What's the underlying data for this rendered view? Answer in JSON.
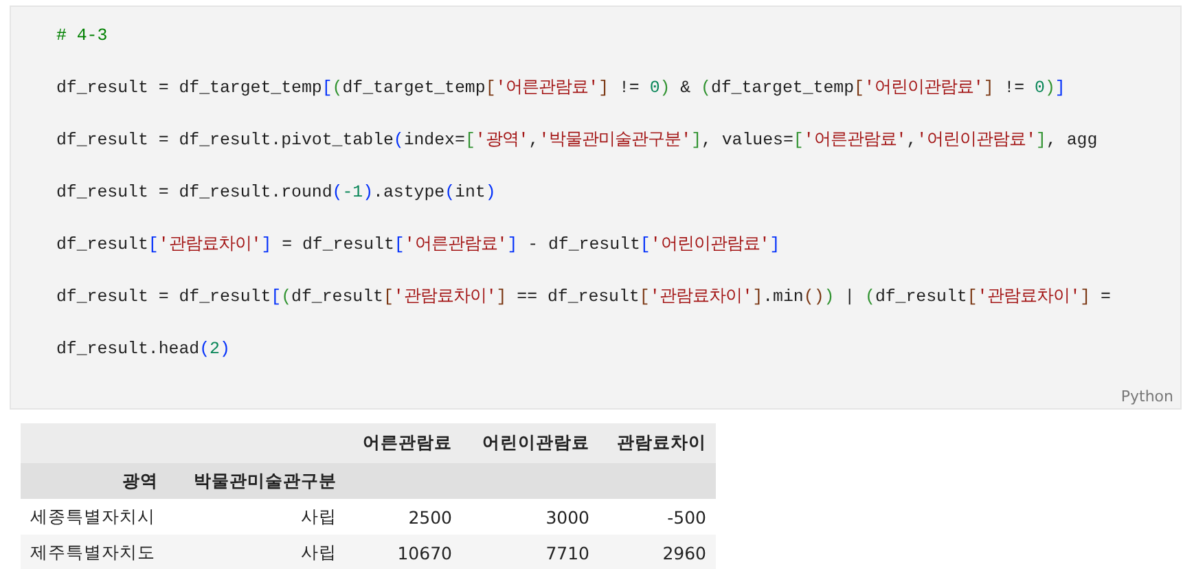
{
  "code_cell": {
    "language": "Python",
    "lines": [
      [
        {
          "text": "# 4-3",
          "kind": "c"
        }
      ],
      [
        {
          "text": "df_result = df_target_temp",
          "kind": "p"
        },
        {
          "text": "[",
          "kind": "b1"
        },
        {
          "text": "(",
          "kind": "b2"
        },
        {
          "text": "df_target_temp",
          "kind": "p"
        },
        {
          "text": "[",
          "kind": "b3"
        },
        {
          "text": "'어른관람료'",
          "kind": "s"
        },
        {
          "text": "]",
          "kind": "b3"
        },
        {
          "text": " != ",
          "kind": "p"
        },
        {
          "text": "0",
          "kind": "n"
        },
        {
          "text": ")",
          "kind": "b2"
        },
        {
          "text": " & ",
          "kind": "p"
        },
        {
          "text": "(",
          "kind": "b2"
        },
        {
          "text": "df_target_temp",
          "kind": "p"
        },
        {
          "text": "[",
          "kind": "b3"
        },
        {
          "text": "'어린이관람료'",
          "kind": "s"
        },
        {
          "text": "]",
          "kind": "b3"
        },
        {
          "text": " != ",
          "kind": "p"
        },
        {
          "text": "0",
          "kind": "n"
        },
        {
          "text": ")",
          "kind": "b2"
        },
        {
          "text": "]",
          "kind": "b1"
        }
      ],
      [
        {
          "text": "df_result = df_result.pivot_table",
          "kind": "p"
        },
        {
          "text": "(",
          "kind": "b1"
        },
        {
          "text": "index=",
          "kind": "p"
        },
        {
          "text": "[",
          "kind": "b2"
        },
        {
          "text": "'광역'",
          "kind": "s"
        },
        {
          "text": ",",
          "kind": "p"
        },
        {
          "text": "'박물관미술관구분'",
          "kind": "s"
        },
        {
          "text": "]",
          "kind": "b2"
        },
        {
          "text": ", values=",
          "kind": "p"
        },
        {
          "text": "[",
          "kind": "b2"
        },
        {
          "text": "'어른관람료'",
          "kind": "s"
        },
        {
          "text": ",",
          "kind": "p"
        },
        {
          "text": "'어린이관람료'",
          "kind": "s"
        },
        {
          "text": "]",
          "kind": "b2"
        },
        {
          "text": ", agg",
          "kind": "p"
        }
      ],
      [
        {
          "text": "df_result = df_result.round",
          "kind": "p"
        },
        {
          "text": "(",
          "kind": "b1"
        },
        {
          "text": "-1",
          "kind": "n"
        },
        {
          "text": ")",
          "kind": "b1"
        },
        {
          "text": ".astype",
          "kind": "p"
        },
        {
          "text": "(",
          "kind": "b1"
        },
        {
          "text": "int",
          "kind": "p"
        },
        {
          "text": ")",
          "kind": "b1"
        }
      ],
      [
        {
          "text": "df_result",
          "kind": "p"
        },
        {
          "text": "[",
          "kind": "b1"
        },
        {
          "text": "'관람료차이'",
          "kind": "s"
        },
        {
          "text": "]",
          "kind": "b1"
        },
        {
          "text": " = df_result",
          "kind": "p"
        },
        {
          "text": "[",
          "kind": "b1"
        },
        {
          "text": "'어른관람료'",
          "kind": "s"
        },
        {
          "text": "]",
          "kind": "b1"
        },
        {
          "text": " - df_result",
          "kind": "p"
        },
        {
          "text": "[",
          "kind": "b1"
        },
        {
          "text": "'어린이관람료'",
          "kind": "s"
        },
        {
          "text": "]",
          "kind": "b1"
        }
      ],
      [
        {
          "text": "df_result = df_result",
          "kind": "p"
        },
        {
          "text": "[",
          "kind": "b1"
        },
        {
          "text": "(",
          "kind": "b2"
        },
        {
          "text": "df_result",
          "kind": "p"
        },
        {
          "text": "[",
          "kind": "b3"
        },
        {
          "text": "'관람료차이'",
          "kind": "s"
        },
        {
          "text": "]",
          "kind": "b3"
        },
        {
          "text": " == df_result",
          "kind": "p"
        },
        {
          "text": "[",
          "kind": "b3"
        },
        {
          "text": "'관람료차이'",
          "kind": "s"
        },
        {
          "text": "]",
          "kind": "b3"
        },
        {
          "text": ".min",
          "kind": "p"
        },
        {
          "text": "(",
          "kind": "b3"
        },
        {
          "text": ")",
          "kind": "b3"
        },
        {
          "text": ")",
          "kind": "b2"
        },
        {
          "text": " | ",
          "kind": "p"
        },
        {
          "text": "(",
          "kind": "b2"
        },
        {
          "text": "df_result",
          "kind": "p"
        },
        {
          "text": "[",
          "kind": "b3"
        },
        {
          "text": "'관람료차이'",
          "kind": "s"
        },
        {
          "text": "]",
          "kind": "b3"
        },
        {
          "text": " =",
          "kind": "p"
        }
      ],
      [
        {
          "text": "df_result.head",
          "kind": "p"
        },
        {
          "text": "(",
          "kind": "b1"
        },
        {
          "text": "2",
          "kind": "n"
        },
        {
          "text": ")",
          "kind": "b1"
        }
      ]
    ]
  },
  "output_table": {
    "columns": [
      "어른관람료",
      "어린이관람료",
      "관람료차이"
    ],
    "index_names": [
      "광역",
      "박물관미술관구분"
    ],
    "rows": [
      {
        "index": [
          "세종특별자치시",
          "사립"
        ],
        "values": [
          "2500",
          "3000",
          "-500"
        ]
      },
      {
        "index": [
          "제주특별자치도",
          "사립"
        ],
        "values": [
          "10670",
          "7710",
          "2960"
        ]
      }
    ]
  }
}
